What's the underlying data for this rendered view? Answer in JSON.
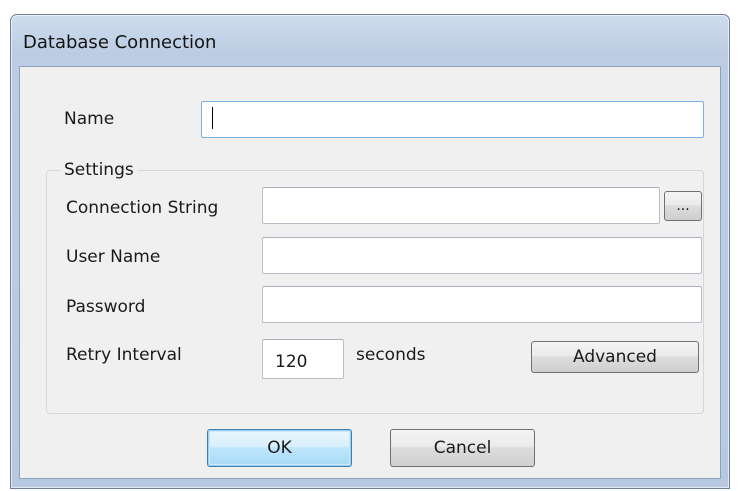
{
  "dialog": {
    "title": "Database Connection"
  },
  "fields": {
    "name_label": "Name",
    "name_value": "",
    "settings_label": "Settings",
    "connection_string_label": "Connection String",
    "connection_string_value": "",
    "browse_label": "...",
    "user_name_label": "User Name",
    "user_name_value": "",
    "password_label": "Password",
    "password_value": "",
    "retry_interval_label": "Retry Interval",
    "retry_interval_value": "120",
    "retry_unit": "seconds",
    "advanced_label": "Advanced"
  },
  "buttons": {
    "ok_label": "OK",
    "cancel_label": "Cancel"
  },
  "colors": {
    "frame": "#b7c9e0",
    "client": "#f0f0f0",
    "default_button_border": "#3c7fb1"
  }
}
